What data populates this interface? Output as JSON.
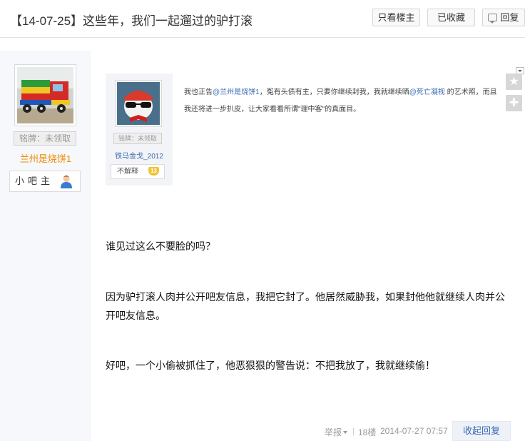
{
  "header": {
    "title": "【14-07-25】这些年，我们一起遛过的驴打滚",
    "only_owner_label": "只看楼主",
    "favorited_label": "已收藏",
    "reply_label": "回复"
  },
  "author": {
    "badge": "铭牌：未领取",
    "username": "兰州是烧饼1",
    "role": "小吧主"
  },
  "quoted_post": {
    "badge": "铭牌：未领取",
    "username": "铁马金戈_2012",
    "tag": "不解释",
    "level": "13",
    "text_parts": [
      "我也正告",
      "@兰州是烧饼1",
      "，冤有头债有主，只要你继续封我，我就继续晒",
      "@死亡凝视",
      " 的艺术照，而且我还将进一步扒皮，让大家看看所谓\"理中客\"的真面目。"
    ]
  },
  "content": {
    "paragraph_1": "谁见过这么不要脸的吗？",
    "paragraph_2": "因为驴打滚人肉并公开吧友信息，我把它封了。他居然威胁我，如果封他他就继续人肉并公开吧友信息。",
    "paragraph_3": "好吧，一个小偷被抓住了，他恶狠狠的警告说：不把我放了，我就继续偷！"
  },
  "footer": {
    "report_label": "举报",
    "separator": "|",
    "floor": "18楼",
    "timestamp": "2014-07-27 07:57",
    "collapse_reply_label": "收起回复"
  },
  "side_tools": {
    "favorite_icon": "star-icon",
    "add_icon": "plus-icon"
  },
  "colors": {
    "link_blue": "#3a6bb3",
    "username_orange": "#f08a00",
    "sidebar_bg": "#f6f8fc"
  }
}
